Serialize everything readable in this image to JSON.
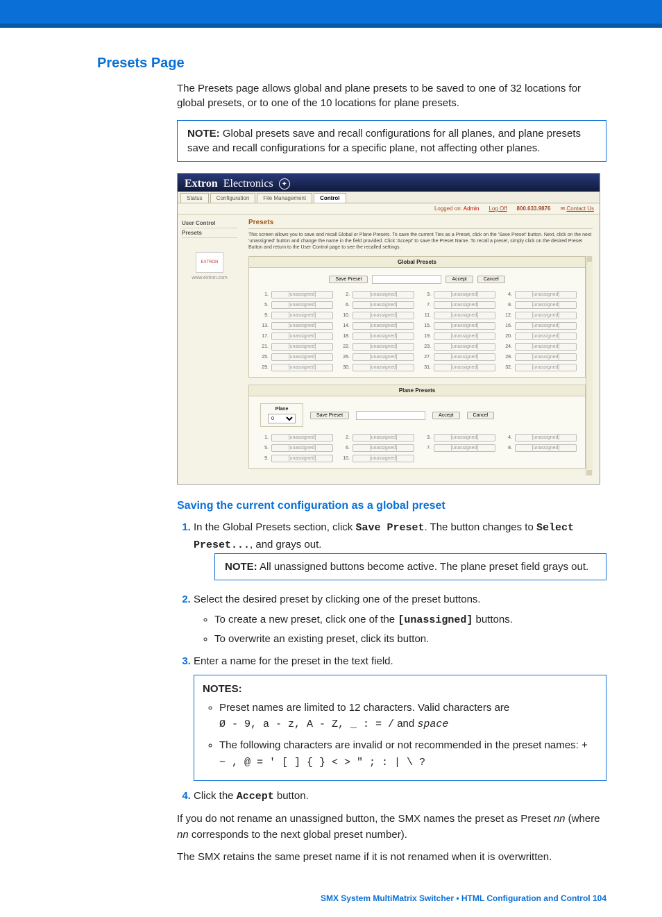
{
  "page": {
    "title": "Presets Page",
    "intro": "The Presets page allows global and plane presets to be saved to one of 32 locations for global presets, or to one of the 10 locations for plane presets.",
    "note1_label": "NOTE:",
    "note1_text": "Global presets save and recall configurations for all planes, and plane presets save and recall configurations for a specific plane, not affecting other planes.",
    "sub_heading": "Saving the current configuration as a global preset",
    "step1_a": "In the Global Presets section, click ",
    "step1_code1": "Save Preset",
    "step1_b": ". The button changes to ",
    "step1_code2": "Select Preset...",
    "step1_c": ", and grays out.",
    "note2_label": "NOTE:",
    "note2_text": "All unassigned buttons become active. The plane preset field grays out.",
    "step2": "Select the desired preset by clicking one of the preset buttons.",
    "step2_bullet1_a": "To create a new preset, click one of the ",
    "step2_bullet1_code": "[unassigned]",
    "step2_bullet1_b": " buttons.",
    "step2_bullet2": "To overwrite an existing preset, click its button.",
    "step3": "Enter a name for the preset in the text field.",
    "notes_title": "NOTES:",
    "notes_b1": "Preset names are limited to 12 characters. Valid characters are",
    "notes_b1_code_a": "Ø - 9, a - z, A - Z, _ : = /",
    "notes_b1_and": " and ",
    "notes_b1_code_b": "space",
    "notes_b2": "The following characters are invalid or not recommended in the preset names: ",
    "notes_b2_code": "+ ~ , @ = ' [ ] { } < > \" ; : | \\ ?",
    "step4_a": "Click the ",
    "step4_code": "Accept",
    "step4_b": " button.",
    "after1_a": "If you do not rename an unassigned button, the SMX names the preset as Preset ",
    "after1_i": "nn",
    "after1_b": " (where ",
    "after1_i2": "nn",
    "after1_c": " corresponds to the next global preset number).",
    "after2": "The SMX retains the same preset name if it is not renamed when it is overwritten.",
    "footer": "SMX System MultiMatrix Switcher • HTML Configuration and Control    104"
  },
  "app": {
    "brand_a": "Extron",
    "brand_b": "Electronics",
    "tabs": [
      "Status",
      "Configuration",
      "File Management",
      "Control"
    ],
    "active_tab": 3,
    "phone": "800.633.9876",
    "logged_as_label": "Logged on:",
    "logged_as_user": "Admin",
    "logoff": "Log Off",
    "contact": "Contact Us",
    "sidebar": {
      "items": [
        "User Control",
        "Presets"
      ],
      "site": "www.extron.com"
    },
    "main_title": "Presets",
    "main_desc": "This screen allows you to save and recall Global or Plane Presets. To save the current Ties as a Preset, click on the 'Save Preset' button. Next, click on the next 'unassigned' button and change the name in the field provided. Click 'Accept' to save the Preset Name. To recall a preset, simply click on the desired Preset Button and return to the User Control page to see the recalled settings.",
    "global": {
      "title": "Global Presets",
      "save": "Save Preset",
      "accept": "Accept",
      "cancel": "Cancel",
      "slot_label": "[unassigned]",
      "count": 32
    },
    "plane": {
      "title": "Plane Presets",
      "plane_label": "Plane",
      "plane_value": "0",
      "save": "Save Preset",
      "accept": "Accept",
      "cancel": "Cancel",
      "slot_label": "[unassigned]",
      "count": 10
    }
  }
}
